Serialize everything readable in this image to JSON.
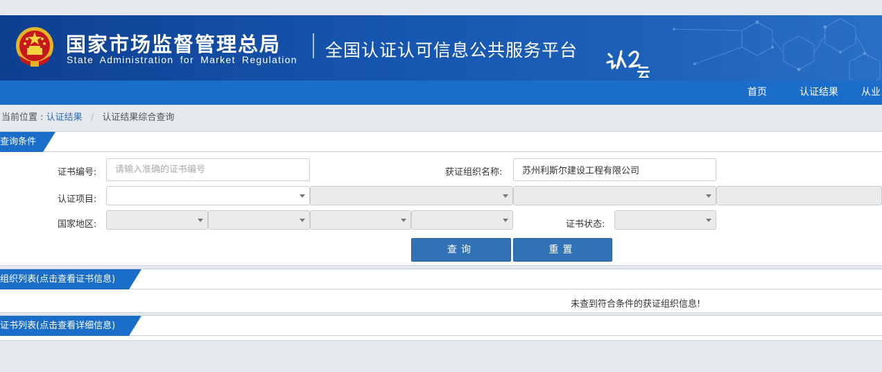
{
  "header": {
    "title_cn": "国家市场监督管理总局",
    "title_en": "State Administration  for  Market Regulation",
    "platform_title": "全国认证认可信息公共服务平台"
  },
  "nav": {
    "items": [
      {
        "label": "首页"
      },
      {
        "label": "认证结果"
      },
      {
        "label": "从业"
      }
    ]
  },
  "breadcrumb": {
    "prefix": "当前位置 :",
    "link": "认证结果",
    "separator": "/",
    "current": "认证结果综合查询"
  },
  "query": {
    "tab_label": "查询条件",
    "cert_no_label": "证书编号:",
    "cert_no_placeholder": "请输入准确的证书编号",
    "cert_no_value": "",
    "org_name_label": "获证组织名称:",
    "org_name_value": "苏州利斯尔建设工程有限公司",
    "project_label": "认证项目:",
    "region_label": "国家地区:",
    "status_label": "证书状态:",
    "search_button": "查询",
    "reset_button": "重置"
  },
  "org_list": {
    "tab_label": "组织列表(点击查看证书信息)",
    "empty_message": "未查到符合条件的获证组织信息!"
  },
  "cert_list": {
    "tab_label": "证书列表(点击查看详细信息)"
  },
  "colors": {
    "header_blue": "#1654ae",
    "nav_blue": "#1a6dc9",
    "button_blue": "#3273b8",
    "link_blue": "#2a6cb5"
  }
}
